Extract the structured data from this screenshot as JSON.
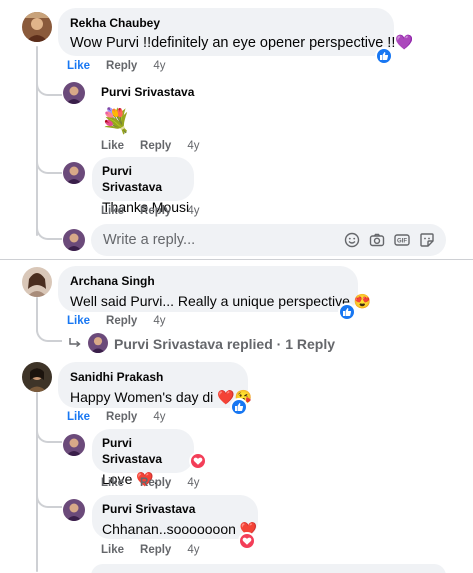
{
  "comments": [
    {
      "author": "Rekha Chaubey",
      "text": "Wow Purvi !!definitely an eye opener perspective !!💜",
      "like": "Like",
      "reply": "Reply",
      "time": "4y",
      "replies": [
        {
          "author": "Purvi Srivastava",
          "text": "💐",
          "like": "Like",
          "reply": "Reply",
          "time": "4y"
        },
        {
          "author": "Purvi Srivastava",
          "text": "Thanks Mousi",
          "like": "Like",
          "reply": "Reply",
          "time": "4y"
        }
      ],
      "reply_placeholder": "Write a reply..."
    },
    {
      "author": "Archana Singh",
      "text": "Well said Purvi... Really a unique perspective 😍",
      "like": "Like",
      "reply": "Reply",
      "time": "4y",
      "replied_summary": {
        "name": "Purvi Srivastava replied",
        "count": "· 1 Reply"
      }
    },
    {
      "author": "Sanidhi Prakash",
      "text": "Happy Women's day di ❤️😘",
      "like": "Like",
      "reply": "Reply",
      "time": "4y",
      "replies": [
        {
          "author": "Purvi Srivastava",
          "text": "Love ❤️.",
          "like": "Like",
          "reply": "Reply",
          "time": "4y"
        },
        {
          "author": "Purvi Srivastava",
          "text": "Chhanan..sooooooon ❤️",
          "like": "Like",
          "reply": "Reply",
          "time": "4y"
        }
      ]
    }
  ],
  "colors": {
    "like_active": "#1877f2",
    "bubble": "#f0f2f5",
    "muted": "#65676b",
    "heart_reaction": "#f33e58"
  },
  "icons": [
    "like-reaction-icon",
    "love-reaction-icon",
    "emoji-icon",
    "camera-icon",
    "gif-icon",
    "sticker-icon",
    "reply-arrow-icon"
  ]
}
